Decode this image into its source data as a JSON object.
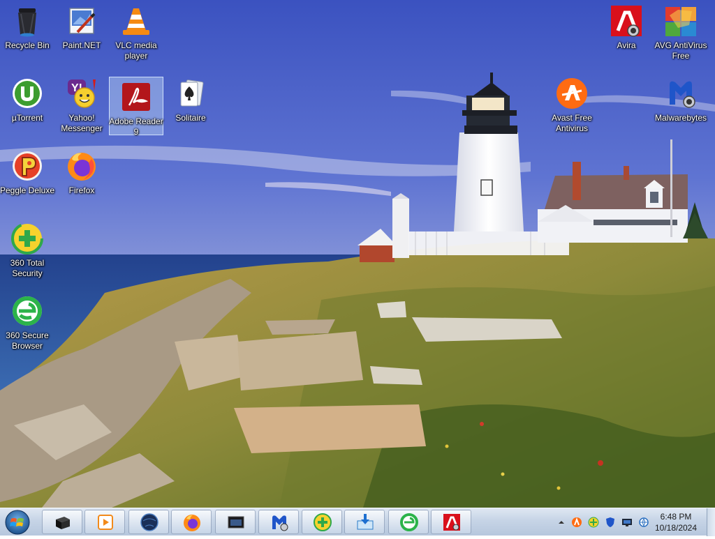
{
  "desktop": {
    "icons": [
      {
        "label": "Recycle Bin"
      },
      {
        "label": "Paint.NET"
      },
      {
        "label": "VLC media player"
      },
      {
        "label": "µTorrent"
      },
      {
        "label": "Yahoo! Messenger"
      },
      {
        "label": "Adobe Reader 9"
      },
      {
        "label": "Solitaire"
      },
      {
        "label": "Peggle Deluxe"
      },
      {
        "label": "Firefox"
      },
      {
        "label": "360 Total Security"
      },
      {
        "label": "360 Secure Browser"
      },
      {
        "label": "Avira"
      },
      {
        "label": "AVG AntiVirus Free"
      },
      {
        "label": "Avast Free Antivirus"
      },
      {
        "label": "Malwarebytes"
      }
    ],
    "selected_icon": "Adobe Reader 9"
  },
  "taskbar": {
    "start_icon": "windows-logo-icon",
    "pinned": [
      {
        "icon": "black-box-app-icon"
      },
      {
        "icon": "media-player-icon"
      },
      {
        "icon": "globe-app-icon"
      },
      {
        "icon": "firefox-icon"
      },
      {
        "icon": "window-app-icon"
      },
      {
        "icon": "malwarebytes-icon"
      },
      {
        "icon": "360-total-security-icon"
      },
      {
        "icon": "download-monitor-icon"
      },
      {
        "icon": "360-secure-browser-icon"
      },
      {
        "icon": "avira-icon"
      }
    ],
    "tray": {
      "icons": [
        "show-hidden-icons-chevron",
        "avast-tray-icon",
        "360-tray-icon",
        "shield-tray-icon",
        "monitor-tray-icon",
        "network-tray-icon"
      ],
      "time": "6:48 PM",
      "date": "10/18/2024"
    }
  },
  "colors": {
    "sky_top": "#3e57c3",
    "sea": "#2a4f99",
    "taskbar": "#c6d4e6"
  }
}
